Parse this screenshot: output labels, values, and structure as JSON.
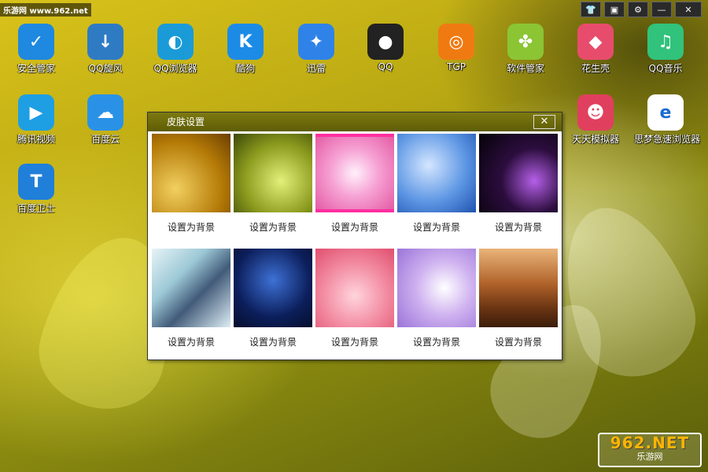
{
  "watermark_top": "乐游网 www.962.net",
  "topbar": {
    "skin_icon": "shirt-icon",
    "window_icon": "window-icon",
    "settings_icon": "gear-icon",
    "minimize": "—",
    "close": "✕"
  },
  "desktop_icons": [
    {
      "label": "安全管家",
      "glyph": "✓",
      "color": "#1f88e0"
    },
    {
      "label": "QQ旋风",
      "glyph": "↓",
      "color": "#2e7bc4"
    },
    {
      "label": "QQ浏览器",
      "glyph": "◐",
      "color": "#1a9bd8"
    },
    {
      "label": "酷狗",
      "glyph": "K",
      "color": "#1c8be6"
    },
    {
      "label": "迅雷",
      "glyph": "✦",
      "color": "#2f83e8"
    },
    {
      "label": "QQ",
      "glyph": "●",
      "color": "#222222"
    },
    {
      "label": "TGP",
      "glyph": "◎",
      "color": "#f07a12"
    },
    {
      "label": "软件管家",
      "glyph": "✤",
      "color": "#8bc534"
    },
    {
      "label": "花生壳",
      "glyph": "◆",
      "color": "#e84c6c"
    },
    {
      "label": "QQ音乐",
      "glyph": "♫",
      "color": "#31c27c"
    },
    {
      "label": "腾讯视频",
      "glyph": "▶",
      "color": "#1e9fe3"
    },
    {
      "label": "百度云",
      "glyph": "☁",
      "color": "#2a92e6"
    },
    {
      "label": "天天模拟器",
      "glyph": "☻",
      "color": "#e0405e"
    },
    {
      "label": "思梦急速浏览器",
      "glyph": "e",
      "color": "#ffffff"
    },
    {
      "label": "百度卫士",
      "glyph": "T",
      "color": "#1f7fd9"
    }
  ],
  "dialog": {
    "title": "皮肤设置",
    "close": "✕",
    "set_button_label": "设置为背景"
  },
  "logo": {
    "text": "962.NET",
    "subtitle": "乐游网"
  }
}
